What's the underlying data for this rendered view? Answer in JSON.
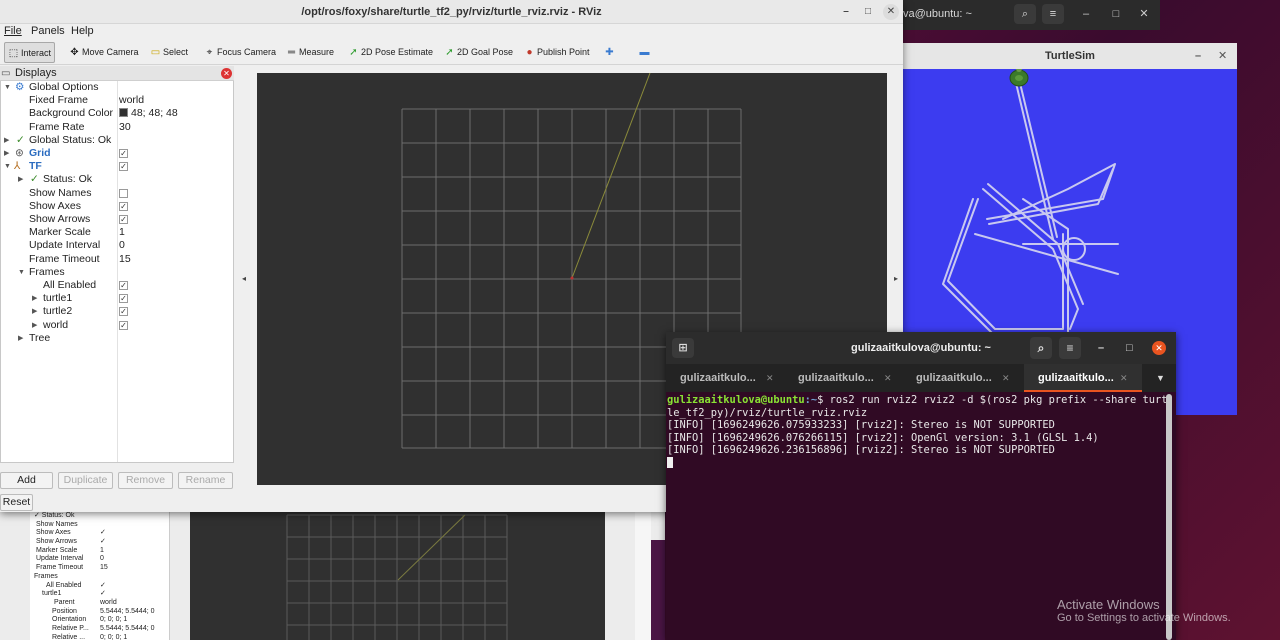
{
  "background_rviz": {
    "rows": [
      {
        "key": "✓ Status: Ok",
        "value": ""
      },
      {
        "key": "Show Names",
        "value": ""
      },
      {
        "key": "Show Axes",
        "value": "✓"
      },
      {
        "key": "Show Arrows",
        "value": "✓"
      },
      {
        "key": "Marker Scale",
        "value": "1"
      },
      {
        "key": "Update Interval",
        "value": "0"
      },
      {
        "key": "Frame Timeout",
        "value": "15"
      },
      {
        "key": "Frames",
        "value": ""
      },
      {
        "key": "All Enabled",
        "value": "✓"
      },
      {
        "key": "turtle1",
        "value": "✓"
      },
      {
        "key": "Parent",
        "value": "world"
      },
      {
        "key": "Position",
        "value": "5.5444; 5.5444; 0"
      },
      {
        "key": "Orientation",
        "value": "0; 0; 0; 1"
      },
      {
        "key": "Relative P...",
        "value": "5.5444; 5.5444; 0"
      },
      {
        "key": "Relative ...",
        "value": "0; 0; 0; 1"
      }
    ]
  },
  "rviz": {
    "title": "/opt/ros/foxy/share/turtle_tf2_py/rviz/turtle_rviz.rviz - RViz",
    "window_controls": {
      "minimize": "–",
      "maximize": "□",
      "close": "✕"
    },
    "menu": [
      "File",
      "Panels",
      "Help"
    ],
    "toolbar": [
      {
        "label": "Interact",
        "icon": "interact-icon",
        "glyph": "⬚"
      },
      {
        "label": "Move Camera",
        "icon": "move-camera-icon",
        "glyph": "✥"
      },
      {
        "label": "Select",
        "icon": "select-icon",
        "glyph": "▭"
      },
      {
        "label": "Focus Camera",
        "icon": "focus-camera-icon",
        "glyph": "⌖"
      },
      {
        "label": "Measure",
        "icon": "measure-icon",
        "glyph": "═"
      },
      {
        "label": "2D Pose Estimate",
        "icon": "pose-estimate-icon",
        "glyph": "➚"
      },
      {
        "label": "2D Goal Pose",
        "icon": "goal-pose-icon",
        "glyph": "➚"
      },
      {
        "label": "Publish Point",
        "icon": "publish-point-icon",
        "glyph": "●"
      },
      {
        "label": "",
        "icon": "plus-icon",
        "glyph": "✚"
      },
      {
        "label": "",
        "icon": "minus-icon",
        "glyph": "▬"
      }
    ],
    "panel_title": "Displays",
    "tree": {
      "global_options": "Global Options",
      "fixed_frame": {
        "label": "Fixed Frame",
        "value": "world"
      },
      "background_color": {
        "label": "Background Color",
        "value": "48; 48; 48"
      },
      "frame_rate": {
        "label": "Frame Rate",
        "value": "30"
      },
      "global_status": "Global Status: Ok",
      "grid": "Grid",
      "tf": "TF",
      "status": "Status: Ok",
      "show_names": "Show Names",
      "show_axes": "Show Axes",
      "show_arrows": "Show Arrows",
      "marker_scale": {
        "label": "Marker Scale",
        "value": "1"
      },
      "update_interval": {
        "label": "Update Interval",
        "value": "0"
      },
      "frame_timeout": {
        "label": "Frame Timeout",
        "value": "15"
      },
      "frames": "Frames",
      "all_enabled": "All Enabled",
      "turtle1": "turtle1",
      "turtle2": "turtle2",
      "world": "world",
      "tree_node": "Tree"
    },
    "checkbox_glyph": "✓",
    "buttons": {
      "add": "Add",
      "duplicate": "Duplicate",
      "remove": "Remove",
      "rename": "Rename",
      "reset": "Reset"
    },
    "viewport_bg": "#303030"
  },
  "bg_terminal_top": {
    "title": "va@ubuntu: ~"
  },
  "turtlesim": {
    "title": "TurtleSim",
    "bg": "#3c3cf0"
  },
  "terminal": {
    "title": "gulizaaitkulova@ubuntu: ~",
    "tabs": [
      "gulizaaitkulo...",
      "gulizaaitkulo...",
      "gulizaaitkulo...",
      "gulizaaitkulo..."
    ],
    "prompt_user": "gulizaaitkulova@ubuntu",
    "prompt_path": ":~",
    "command": "$ ros2 run rviz2 rviz2 -d $(ros2 pkg prefix --share turt",
    "command_wrap": "le_tf2_py)/rviz/turtle_rviz.rviz",
    "lines": [
      "[INFO] [1696249626.075933233] [rviz2]: Stereo is NOT SUPPORTED",
      "[INFO] [1696249626.076266115] [rviz2]: OpenGl version: 3.1 (GLSL 1.4)",
      "[INFO] [1696249626.236156896] [rviz2]: Stereo is NOT SUPPORTED"
    ]
  },
  "watermark": {
    "title": "Activate Windows",
    "subtitle": "Go to Settings to activate Windows."
  }
}
